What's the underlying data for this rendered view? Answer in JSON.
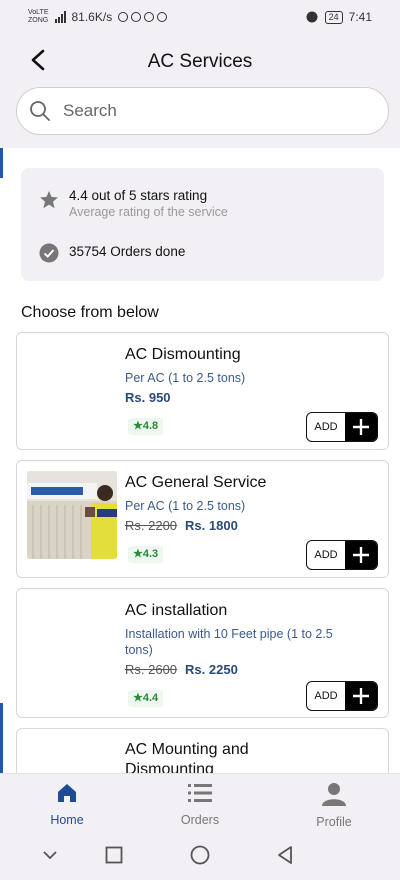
{
  "status_bar": {
    "carrier_top": "VoLTE",
    "carrier_bottom": "ZONG",
    "net_speed": "81.6K/s",
    "battery": "24",
    "time": "7:41"
  },
  "header": {
    "title": "AC Services",
    "back_icon": "chevron-left-icon"
  },
  "search": {
    "placeholder": "Search",
    "value": ""
  },
  "stats": {
    "rating_line": "4.4 out of 5 stars rating",
    "rating_sub": "Average rating of the service",
    "orders_line": "35754 Orders done"
  },
  "section_title": "Choose from below",
  "services": [
    {
      "name": "AC Dismounting",
      "description": "Per AC (1 to 2.5 tons)",
      "old_price": "",
      "price": "Rs. 950",
      "rating": "★4.8",
      "add_label": "ADD",
      "has_image": false
    },
    {
      "name": "AC General Service",
      "description": "Per AC (1 to 2.5 tons)",
      "old_price": "Rs. 2200",
      "price": "Rs. 1800",
      "rating": "★4.3",
      "add_label": "ADD",
      "has_image": true
    },
    {
      "name": "AC installation",
      "description": "Installation with 10 Feet pipe (1 to 2.5 tons)",
      "old_price": "Rs. 2600",
      "price": "Rs. 2250",
      "rating": "★4.4",
      "add_label": "ADD",
      "has_image": false
    },
    {
      "name": "AC Mounting and Dismounting",
      "has_image": false
    }
  ],
  "bottom_nav": {
    "home": "Home",
    "orders": "Orders",
    "profile": "Profile",
    "active_color": "#1e4a9a",
    "inactive_color": "#777777"
  },
  "colors": {
    "background": "#f2f0f5",
    "price_blue": "#2a4a7a",
    "rating_green": "#2a8a3a"
  }
}
